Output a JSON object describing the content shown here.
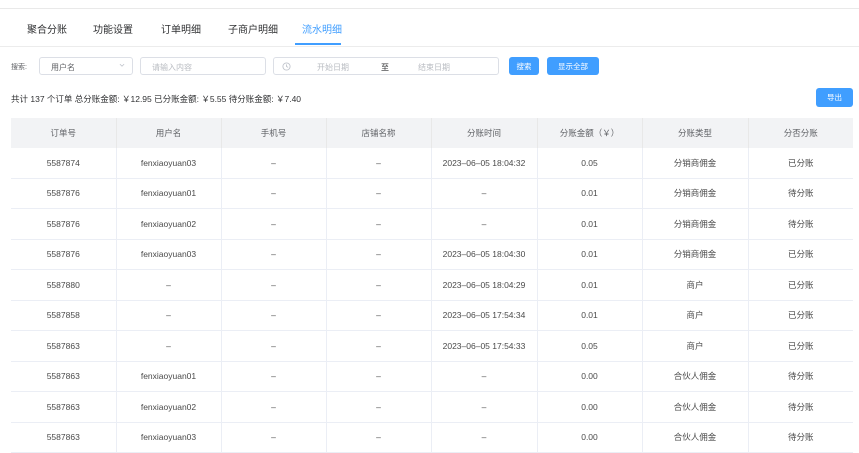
{
  "tabs": [
    {
      "label": "聚合分账"
    },
    {
      "label": "功能设置"
    },
    {
      "label": "订单明细"
    },
    {
      "label": "子商户明细"
    },
    {
      "label": "流水明细"
    }
  ],
  "active_tab": "流水明细",
  "filters": {
    "search_label": "搜索:",
    "select_value": "用户名",
    "keyword_placeholder": "请输入内容",
    "start_placeholder": "开始日期",
    "range_separator": "至",
    "end_placeholder": "结束日期",
    "search_button": "搜索",
    "show_all_button": "显示全部"
  },
  "summary": "共计 137 个订单 总分账金额: ￥12.95 已分账金额: ￥5.55 待分账金额: ￥7.40",
  "export_button": "导出",
  "table": {
    "columns": [
      "订单号",
      "用户名",
      "手机号",
      "店铺名称",
      "分账时间",
      "分账金额（￥）",
      "分账类型",
      "分否分账"
    ],
    "rows": [
      [
        "5587874",
        "fenxiaoyuan03",
        "–",
        "–",
        "2023–06–05 18:04:32",
        "0.05",
        "分销商佣金",
        "已分账"
      ],
      [
        "5587876",
        "fenxiaoyuan01",
        "–",
        "–",
        "–",
        "0.01",
        "分销商佣金",
        "待分账"
      ],
      [
        "5587876",
        "fenxiaoyuan02",
        "–",
        "–",
        "–",
        "0.01",
        "分销商佣金",
        "待分账"
      ],
      [
        "5587876",
        "fenxiaoyuan03",
        "–",
        "–",
        "2023–06–05 18:04:30",
        "0.01",
        "分销商佣金",
        "已分账"
      ],
      [
        "5587880",
        "–",
        "–",
        "–",
        "2023–06–05 18:04:29",
        "0.01",
        "商户",
        "已分账"
      ],
      [
        "5587858",
        "–",
        "–",
        "–",
        "2023–06–05 17:54:34",
        "0.01",
        "商户",
        "已分账"
      ],
      [
        "5587863",
        "–",
        "–",
        "–",
        "2023–06–05 17:54:33",
        "0.05",
        "商户",
        "已分账"
      ],
      [
        "5587863",
        "fenxiaoyuan01",
        "–",
        "–",
        "–",
        "0.00",
        "合伙人佣金",
        "待分账"
      ],
      [
        "5587863",
        "fenxiaoyuan02",
        "–",
        "–",
        "–",
        "0.00",
        "合伙人佣金",
        "待分账"
      ],
      [
        "5587863",
        "fenxiaoyuan03",
        "–",
        "–",
        "–",
        "0.00",
        "合伙人佣金",
        "待分账"
      ]
    ]
  },
  "colors": {
    "accent": "#409eff",
    "header_bg": "#f2f3f5"
  },
  "icons": {
    "select": "chevron-down-icon",
    "date": "clock-icon"
  }
}
